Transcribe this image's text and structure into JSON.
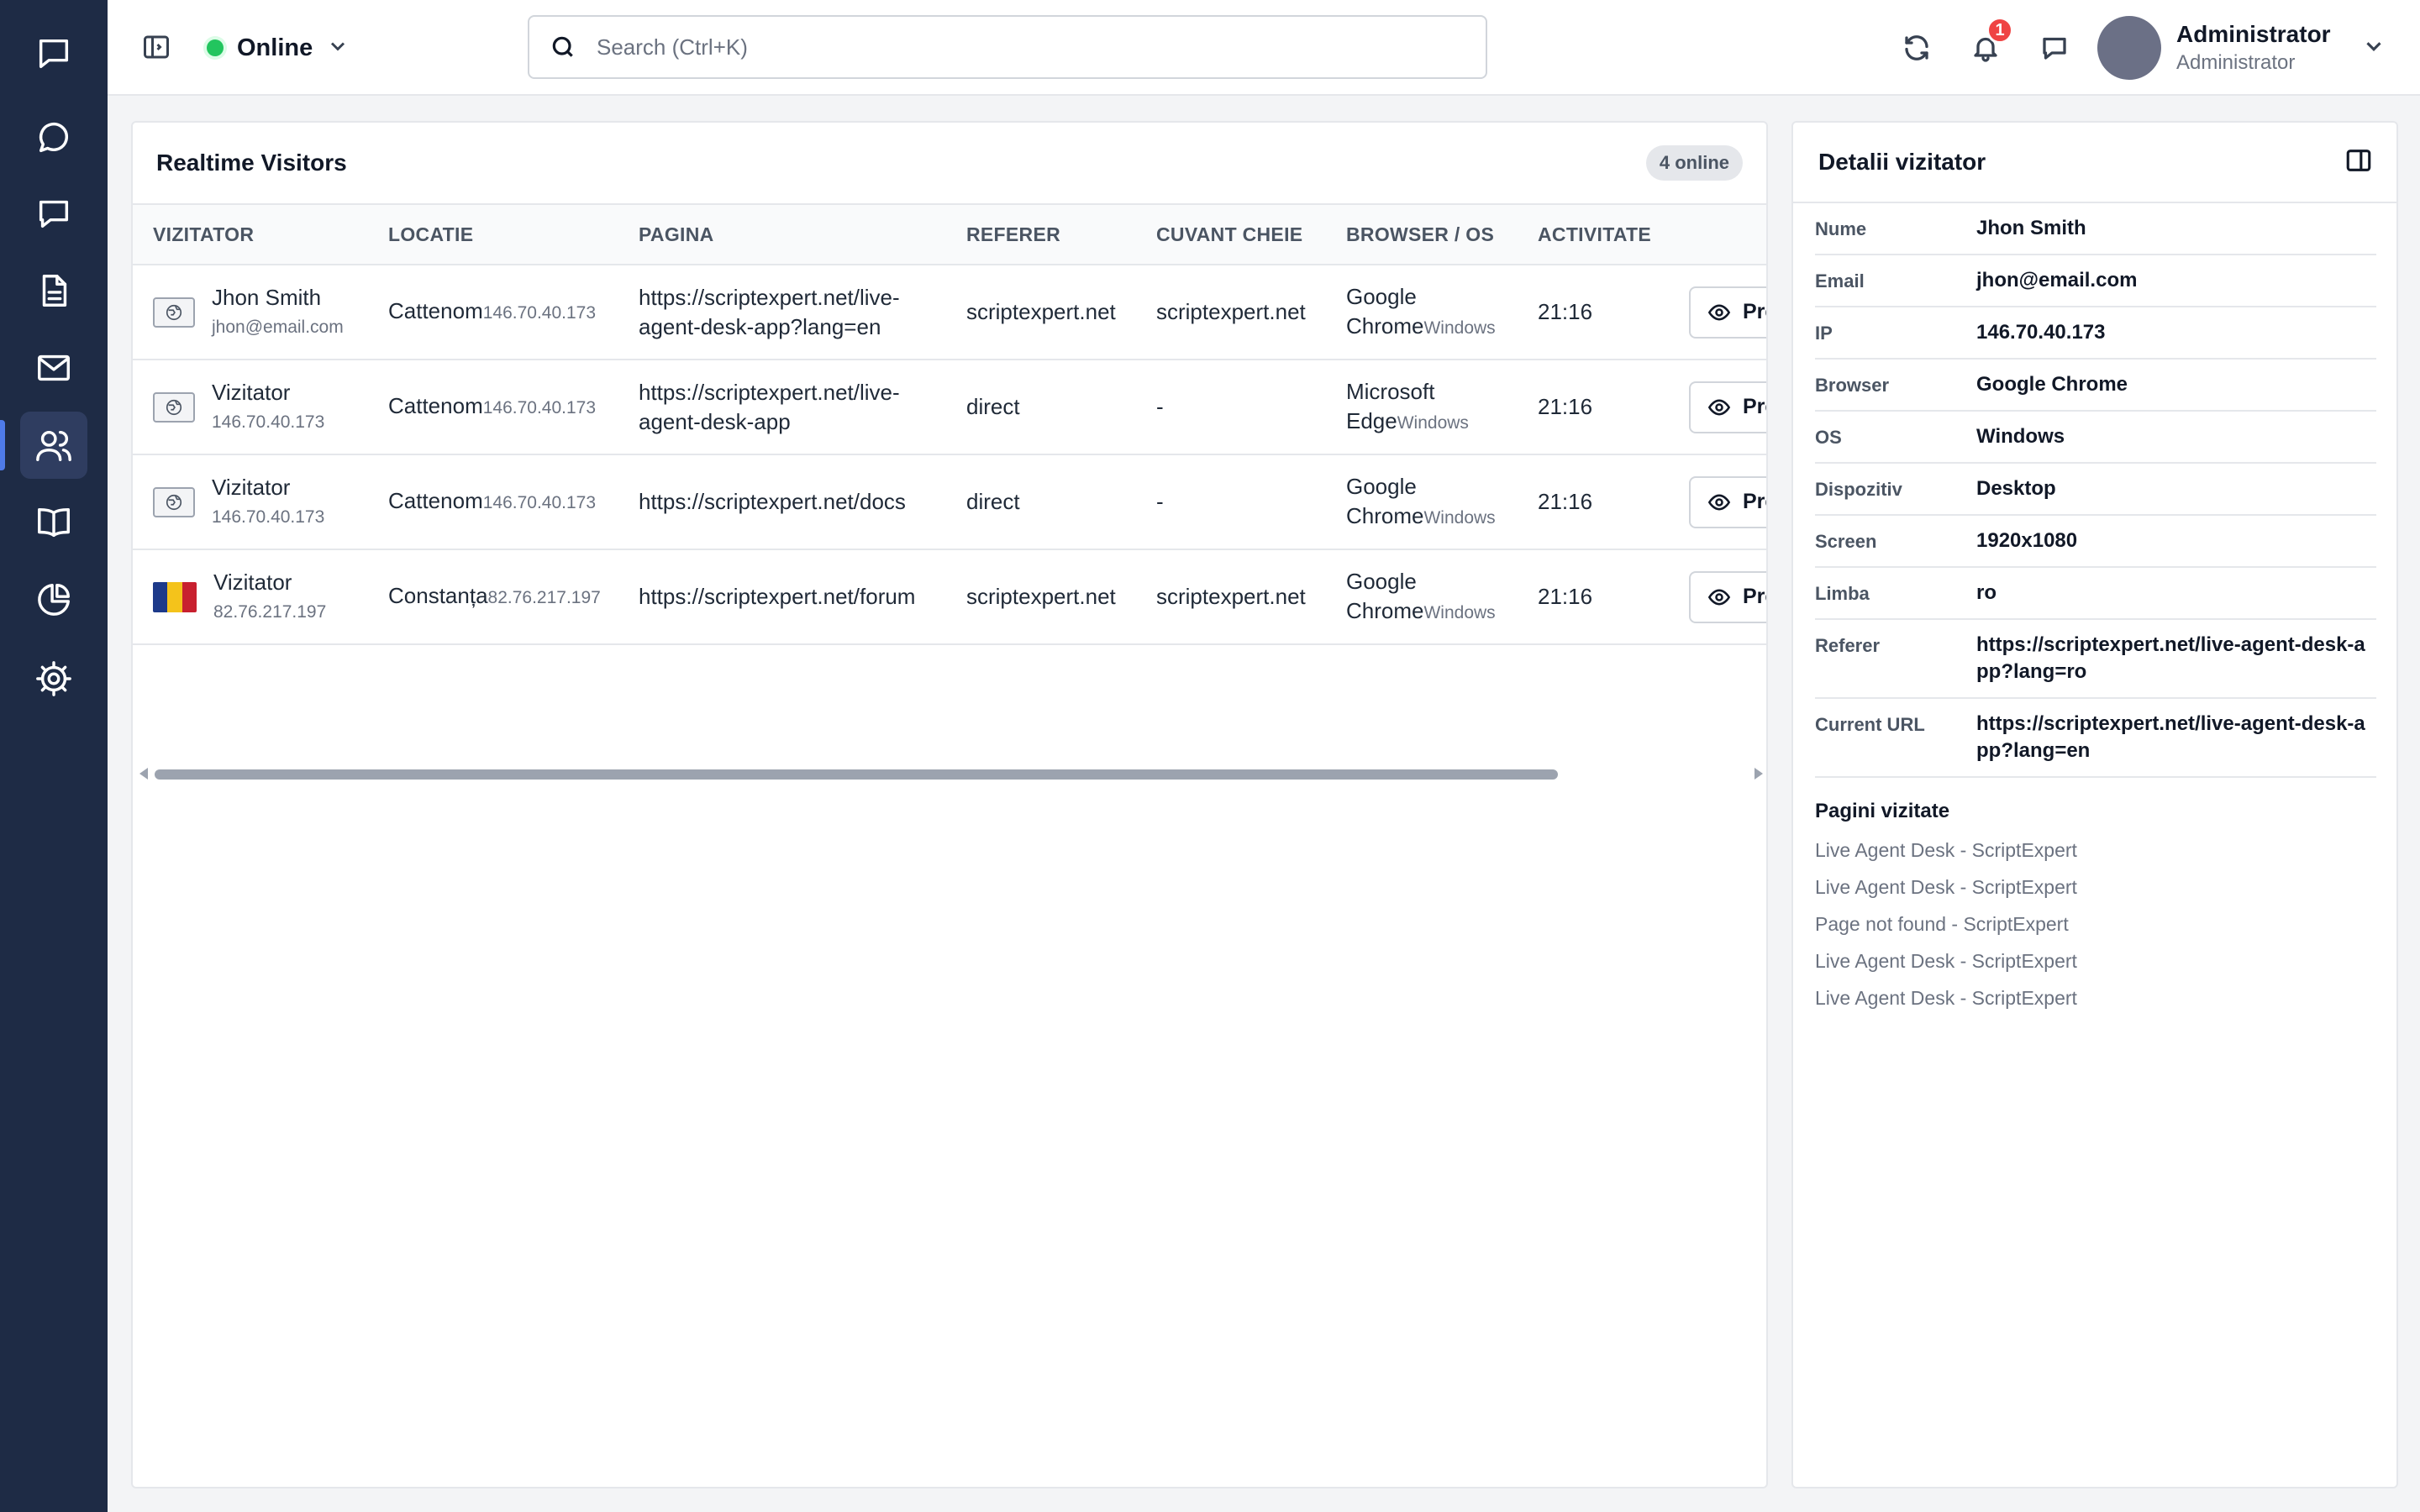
{
  "nav": {
    "items": [
      {
        "name": "conversations",
        "icon": "chat-square-icon"
      },
      {
        "name": "chat",
        "icon": "chat-bubble-icon"
      },
      {
        "name": "messages",
        "icon": "message-icon"
      },
      {
        "name": "documents",
        "icon": "document-icon"
      },
      {
        "name": "email",
        "icon": "mail-icon"
      },
      {
        "name": "visitors",
        "icon": "users-icon",
        "active": true
      },
      {
        "name": "knowledge-base",
        "icon": "book-icon"
      },
      {
        "name": "reports",
        "icon": "pie-chart-icon"
      },
      {
        "name": "settings",
        "icon": "gear-icon"
      }
    ]
  },
  "header": {
    "status": "Online",
    "status_color": "#22c55e",
    "search_placeholder": "Search (Ctrl+K)",
    "notifications_count": "1",
    "user_name": "Administrator",
    "user_role": "Administrator"
  },
  "visitors": {
    "title": "Realtime Visitors",
    "online_badge": "4 online",
    "columns": [
      "VIZITATOR",
      "LOCATIE",
      "PAGINA",
      "REFERER",
      "CUVANT CHEIE",
      "BROWSER / OS",
      "ACTIVITATE"
    ],
    "preview_label": "Preview",
    "rows": [
      {
        "name": "Jhon Smith",
        "sub": "jhon@email.com",
        "flag": "generic",
        "city": "Cattenom",
        "ip": "146.70.40.173",
        "page": "https://scriptexpert.net/live-agent-desk-app?lang=en",
        "referer": "scriptexpert.net",
        "keyword": "scriptexpert.net",
        "browser": "Google Chrome",
        "os": "Windows",
        "activity": "21:16"
      },
      {
        "name": "Vizitator",
        "sub": "146.70.40.173",
        "flag": "generic",
        "city": "Cattenom",
        "ip": "146.70.40.173",
        "page": "https://scriptexpert.net/live-agent-desk-app",
        "referer": "direct",
        "keyword": "-",
        "browser": "Microsoft Edge",
        "os": "Windows",
        "activity": "21:16"
      },
      {
        "name": "Vizitator",
        "sub": "146.70.40.173",
        "flag": "generic",
        "city": "Cattenom",
        "ip": "146.70.40.173",
        "page": "https://scriptexpert.net/docs",
        "referer": "direct",
        "keyword": "-",
        "browser": "Google Chrome",
        "os": "Windows",
        "activity": "21:16"
      },
      {
        "name": "Vizitator",
        "sub": "82.76.217.197",
        "flag": "romania",
        "city": "Constanța",
        "ip": "82.76.217.197",
        "page": "https://scriptexpert.net/forum",
        "referer": "scriptexpert.net",
        "keyword": "scriptexpert.net",
        "browser": "Google Chrome",
        "os": "Windows",
        "activity": "21:16"
      }
    ]
  },
  "details": {
    "title": "Detalii vizitator",
    "fields": [
      {
        "key": "Nume",
        "value": "Jhon Smith"
      },
      {
        "key": "Email",
        "value": "jhon@email.com"
      },
      {
        "key": "IP",
        "value": "146.70.40.173"
      },
      {
        "key": "Browser",
        "value": "Google Chrome"
      },
      {
        "key": "OS",
        "value": "Windows"
      },
      {
        "key": "Dispozitiv",
        "value": "Desktop"
      },
      {
        "key": "Screen",
        "value": "1920x1080"
      },
      {
        "key": "Limba",
        "value": "ro"
      },
      {
        "key": "Referer",
        "value": "https://scriptexpert.net/live-agent-desk-app?lang=ro"
      },
      {
        "key": "Current URL",
        "value": "https://scriptexpert.net/live-agent-desk-app?lang=en"
      }
    ],
    "visited_title": "Pagini vizitate",
    "visited_pages": [
      "Live Agent Desk - ScriptExpert",
      "Live Agent Desk - ScriptExpert",
      "Page not found - ScriptExpert",
      "Live Agent Desk - ScriptExpert",
      "Live Agent Desk - ScriptExpert"
    ]
  }
}
